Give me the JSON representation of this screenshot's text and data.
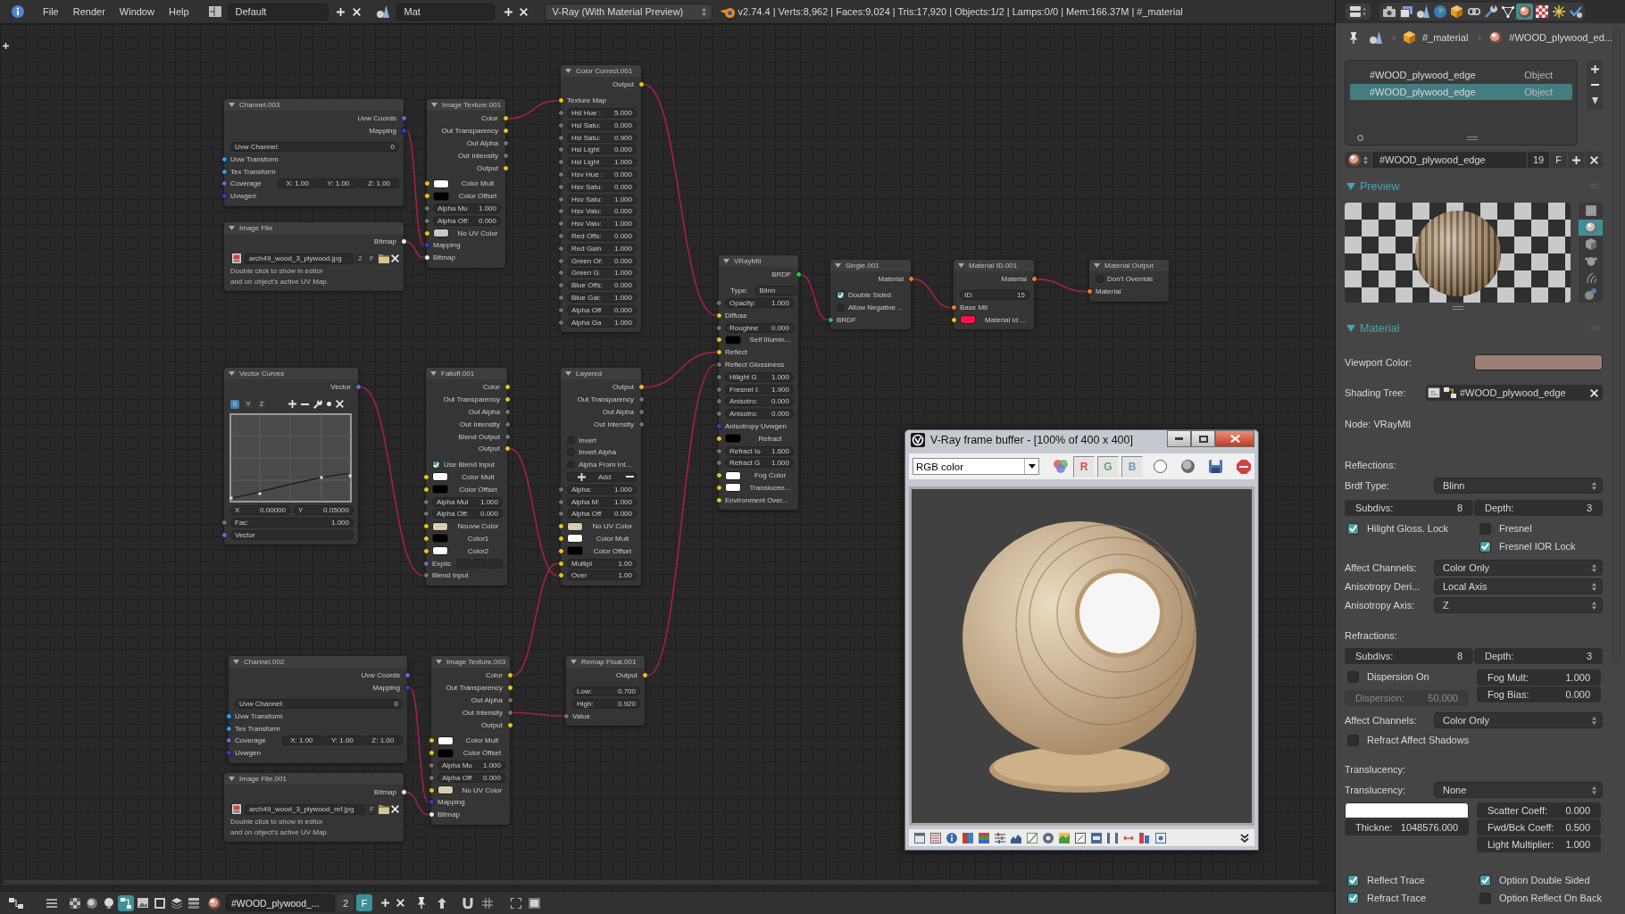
{
  "top_bar": {
    "menus": [
      "File",
      "Render",
      "Window",
      "Help"
    ],
    "layout": "Default",
    "scene": "Mat",
    "engine": "V-Ray (With Material Preview)",
    "stats": "v2.74.4 | Verts:8,962 | Faces:9,024 | Tris:17,920 | Objects:1/2 | Lamps:0/0 | Mem:166.37M | #_material"
  },
  "nodes": [
    {
      "title": "Channel.003",
      "expanded": true,
      "rows": [
        {
          "kind": "out",
          "label": "Uvw Coords",
          "socket": {
            "color": "#6a6ad6"
          }
        },
        {
          "kind": "out",
          "label": "Mapping",
          "socket": {
            "color": "#3a3ac8"
          }
        },
        {
          "kind": "field",
          "label": "Uvw Channel:",
          "value": "0"
        },
        {
          "kind": "in",
          "label": "Uvw Transform",
          "socket": {
            "color": "#2a9df4"
          }
        },
        {
          "kind": "in",
          "label": "Tex Transform",
          "socket": {
            "color": "#2a9df4"
          }
        },
        {
          "kind": "xyz",
          "label": "Coverage",
          "socket": {
            "color": "#6a6ad6"
          },
          "values": [
            "X: 1.00",
            "Y: 1.00",
            "Z: 1.00"
          ]
        },
        {
          "kind": "in",
          "label": "Uvwgen",
          "socket": {
            "color": "#3a3ac8"
          }
        }
      ]
    },
    {
      "title": "Image File",
      "expanded": true,
      "rows": [
        {
          "kind": "out",
          "label": "Bitmap",
          "socket": {
            "color": "#f2f2f2"
          }
        },
        {
          "kind": "file",
          "name": "arch49_wood_3_plywood.jpg",
          "users": "2",
          "fake_user": "F"
        },
        {
          "kind": "note",
          "text": "Double click to show in editor"
        },
        {
          "kind": "note",
          "text": "and on object's active UV Map."
        }
      ]
    },
    {
      "title": "Image Texture.001",
      "expanded": true,
      "rows": [
        {
          "kind": "out",
          "label": "Color",
          "socket": {
            "color": "#e6c41e"
          }
        },
        {
          "kind": "out",
          "label": "Out Transparency",
          "socket": {
            "color": "#e6c41e"
          }
        },
        {
          "kind": "out",
          "label": "Out Alpha",
          "socket": {
            "color": "#737373"
          }
        },
        {
          "kind": "out",
          "label": "Out Intensity",
          "socket": {
            "color": "#737373"
          }
        },
        {
          "kind": "out",
          "label": "Output",
          "socket": {
            "color": "#e6c41e"
          }
        },
        {
          "kind": "color",
          "label": "Color Mult",
          "socket": {
            "color": "#e6c41e"
          },
          "color": "#ffffff"
        },
        {
          "kind": "color",
          "label": "Color Offset",
          "socket": {
            "color": "#e6c41e"
          },
          "color": "#000000"
        },
        {
          "kind": "field",
          "label": "Alpha Mu",
          "value": "1.000",
          "socket": {
            "color": "#737373"
          }
        },
        {
          "kind": "field",
          "label": "Alpha Off:",
          "value": "0.000",
          "socket": {
            "color": "#737373"
          }
        },
        {
          "kind": "color",
          "label": "No UV Color",
          "socket": {
            "color": "#e6c41e"
          },
          "color": "#c8c8c8"
        },
        {
          "kind": "in",
          "label": "Mapping",
          "socket": {
            "color": "#3a3ac8"
          }
        },
        {
          "kind": "in",
          "label": "Bitmap",
          "socket": {
            "color": "#f2f2f2"
          }
        }
      ]
    },
    {
      "title": "Color Correct.001",
      "expanded": true,
      "rows": [
        {
          "kind": "out",
          "label": "Output",
          "socket": {
            "color": "#e6c41e"
          }
        },
        {
          "kind": "in",
          "label": "Texture Map",
          "socket": {
            "color": "#e6c41e"
          }
        },
        {
          "kind": "field",
          "label": "Hsl Hue :",
          "value": "5.000",
          "socket": {
            "color": "#737373"
          }
        },
        {
          "kind": "field",
          "label": "Hsl Satu:",
          "value": "0.000",
          "socket": {
            "color": "#737373"
          }
        },
        {
          "kind": "field",
          "label": "Hsl Satu:",
          "value": "0.900",
          "socket": {
            "color": "#737373"
          }
        },
        {
          "kind": "field",
          "label": "Hsl Light",
          "value": "0.000",
          "socket": {
            "color": "#737373"
          }
        },
        {
          "kind": "field",
          "label": "Hsl Light",
          "value": "1.000",
          "socket": {
            "color": "#737373"
          }
        },
        {
          "kind": "field",
          "label": "Hsv Hue :",
          "value": "0.000",
          "socket": {
            "color": "#737373"
          }
        },
        {
          "kind": "field",
          "label": "Hsv Satu:",
          "value": "0.000",
          "socket": {
            "color": "#737373"
          }
        },
        {
          "kind": "field",
          "label": "Hsv Satu:",
          "value": "1.000",
          "socket": {
            "color": "#737373"
          }
        },
        {
          "kind": "field",
          "label": "Hsv Valu:",
          "value": "0.000",
          "socket": {
            "color": "#737373"
          }
        },
        {
          "kind": "field",
          "label": "Hsv Valu:",
          "value": "1.000",
          "socket": {
            "color": "#737373"
          }
        },
        {
          "kind": "field",
          "label": "Red Offs:",
          "value": "0.000",
          "socket": {
            "color": "#737373"
          }
        },
        {
          "kind": "field",
          "label": "Red Gain",
          "value": "1.000",
          "socket": {
            "color": "#737373"
          }
        },
        {
          "kind": "field",
          "label": "Green Of:",
          "value": "0.000",
          "socket": {
            "color": "#737373"
          }
        },
        {
          "kind": "field",
          "label": "Green G:",
          "value": "1.000",
          "socket": {
            "color": "#737373"
          }
        },
        {
          "kind": "field",
          "label": "Blue Offs:",
          "value": "0.000",
          "socket": {
            "color": "#737373"
          }
        },
        {
          "kind": "field",
          "label": "Blue Gai:",
          "value": "1.000",
          "socket": {
            "color": "#737373"
          }
        },
        {
          "kind": "field",
          "label": "Alpha Off",
          "value": "0.000",
          "socket": {
            "color": "#737373"
          }
        },
        {
          "kind": "field",
          "label": "Alpha Ga",
          "value": "1.000",
          "socket": {
            "color": "#737373"
          }
        }
      ]
    },
    {
      "title": "VRayMtl",
      "expanded": true,
      "rows": [
        {
          "kind": "out",
          "label": "BRDF",
          "socket": {
            "color": "#33c24a"
          }
        },
        {
          "kind": "select",
          "label": "Type:",
          "value": "Blinn"
        },
        {
          "kind": "field",
          "label": "Opacity:",
          "value": "1.000",
          "socket": {
            "color": "#737373"
          }
        },
        {
          "kind": "in",
          "label": "Diffuse",
          "socket": {
            "color": "#e6c41e"
          }
        },
        {
          "kind": "field",
          "label": "Roughne",
          "value": "0.000",
          "socket": {
            "color": "#737373"
          }
        },
        {
          "kind": "color",
          "label": "Self Illumin...",
          "socket": {
            "color": "#e6c41e"
          },
          "color": "#000000"
        },
        {
          "kind": "in",
          "label": "Reflect",
          "socket": {
            "color": "#e6c41e"
          }
        },
        {
          "kind": "in",
          "label": "Reflect Glossiness",
          "socket": {
            "color": "#737373"
          }
        },
        {
          "kind": "field",
          "label": "Hilight G",
          "value": "1.000",
          "socket": {
            "color": "#737373"
          }
        },
        {
          "kind": "field",
          "label": "Fresnel I:",
          "value": "1.900",
          "socket": {
            "color": "#737373"
          }
        },
        {
          "kind": "field",
          "label": "Anisotro:",
          "value": "0.000",
          "socket": {
            "color": "#737373"
          }
        },
        {
          "kind": "field",
          "label": "Anisotro:",
          "value": "0.000",
          "socket": {
            "color": "#737373"
          }
        },
        {
          "kind": "in",
          "label": "Anisotropy Uvwgen",
          "socket": {
            "color": "#3a3ac8"
          }
        },
        {
          "kind": "color",
          "label": "Refract",
          "socket": {
            "color": "#e6c41e"
          },
          "color": "#000000"
        },
        {
          "kind": "field",
          "label": "Refract Io",
          "value": "1.600",
          "socket": {
            "color": "#737373"
          }
        },
        {
          "kind": "field",
          "label": "Refract G",
          "value": "1.000",
          "socket": {
            "color": "#737373"
          }
        },
        {
          "kind": "color",
          "label": "Fog Color",
          "socket": {
            "color": "#e6c41e"
          },
          "color": "#ffffff"
        },
        {
          "kind": "color",
          "label": "Translucen...",
          "socket": {
            "color": "#e6c41e"
          },
          "color": "#ffffff"
        },
        {
          "kind": "in",
          "label": "Environment Over...",
          "socket": {
            "color": "#e6c41e"
          }
        }
      ]
    },
    {
      "title": "Single.001",
      "expanded": true,
      "rows": [
        {
          "kind": "out",
          "label": "Material",
          "socket": {
            "color": "#f07d2a"
          }
        },
        {
          "kind": "check",
          "label": "Double Sided",
          "checked": true
        },
        {
          "kind": "check",
          "label": "Allow Negative ...",
          "checked": false
        },
        {
          "kind": "in",
          "label": "BRDF",
          "socket": {
            "color": "#33c24a"
          }
        }
      ]
    },
    {
      "title": "Material ID.001",
      "expanded": true,
      "rows": [
        {
          "kind": "out",
          "label": "Material",
          "socket": {
            "color": "#f07d2a"
          }
        },
        {
          "kind": "field",
          "label": "ID:",
          "value": "15"
        },
        {
          "kind": "in",
          "label": "Base Mtl",
          "socket": {
            "color": "#f07d2a"
          }
        },
        {
          "kind": "color",
          "label": "Material Id ...",
          "socket": {
            "color": "#e6c41e"
          },
          "color": "#f0144c"
        }
      ]
    },
    {
      "title": "Material Output",
      "expanded": true,
      "rows": [
        {
          "kind": "check",
          "label": "Don't Override",
          "checked": false
        },
        {
          "kind": "in",
          "label": "Material",
          "socket": {
            "color": "#f07d2a"
          }
        }
      ]
    },
    {
      "title": "Vector Curves",
      "expanded": true,
      "rows": [
        {
          "kind": "out",
          "label": "Vector",
          "socket": {
            "color": "#6a6ad6"
          }
        },
        {
          "kind": "curvetools",
          "axes": [
            {
              "label": "X",
              "selected": true
            },
            {
              "label": "Y",
              "selected": false
            },
            {
              "label": "Z",
              "selected": false
            }
          ]
        },
        {
          "kind": "curve"
        },
        {
          "kind": "pair",
          "fields": [
            {
              "label": "X",
              "value": "0.00000"
            },
            {
              "label": "Y",
              "value": "0.05000"
            }
          ]
        },
        {
          "kind": "field",
          "label": "Fac:",
          "value": "1.000",
          "socket": {
            "color": "#737373"
          }
        },
        {
          "kind": "bar",
          "label": "Vector",
          "socket": {
            "color": "#6a6ad6"
          }
        }
      ]
    },
    {
      "title": "Falloff.001",
      "expanded": true,
      "rows": [
        {
          "kind": "out",
          "label": "Color",
          "socket": {
            "color": "#e6c41e"
          }
        },
        {
          "kind": "out",
          "label": "Out Transparency",
          "socket": {
            "color": "#e6c41e"
          }
        },
        {
          "kind": "out",
          "label": "Out Alpha",
          "socket": {
            "color": "#737373"
          }
        },
        {
          "kind": "out",
          "label": "Out Intensity",
          "socket": {
            "color": "#737373"
          }
        },
        {
          "kind": "out",
          "label": "Blend Output",
          "socket": {
            "color": "#737373"
          }
        },
        {
          "kind": "out",
          "label": "Output",
          "socket": {
            "color": "#e6c41e"
          }
        },
        {
          "kind": "check",
          "label": "Use Blend Input",
          "checked": true
        },
        {
          "kind": "color",
          "label": "Color Mult",
          "socket": {
            "color": "#e6c41e"
          },
          "color": "#ffffff"
        },
        {
          "kind": "color",
          "label": "Color Offset",
          "socket": {
            "color": "#e6c41e"
          },
          "color": "#000000"
        },
        {
          "kind": "field",
          "label": "Alpha Mul",
          "value": "1.000",
          "socket": {
            "color": "#737373"
          }
        },
        {
          "kind": "field",
          "label": "Alpha Off:",
          "value": "0.000",
          "socket": {
            "color": "#737373"
          }
        },
        {
          "kind": "color",
          "label": "Nouvw Color",
          "socket": {
            "color": "#e6c41e"
          },
          "color": "#d4cdb2"
        },
        {
          "kind": "color",
          "label": "Color1",
          "socket": {
            "color": "#e6c41e"
          },
          "color": "#000000"
        },
        {
          "kind": "color",
          "label": "Color2",
          "socket": {
            "color": "#e6c41e"
          },
          "color": "#ffffff"
        },
        {
          "kind": "vec",
          "label": "Explic",
          "socket": {
            "color": "#6a6ad6"
          }
        },
        {
          "kind": "in",
          "label": "Blend Input",
          "socket": {
            "color": "#737373"
          }
        }
      ]
    },
    {
      "title": "Layered",
      "expanded": true,
      "rows": [
        {
          "kind": "out",
          "label": "Output",
          "socket": {
            "color": "#e6c41e"
          }
        },
        {
          "kind": "out",
          "label": "Out Transparency",
          "socket": {
            "color": "#737373"
          }
        },
        {
          "kind": "out",
          "label": "Out Alpha",
          "socket": {
            "color": "#737373"
          }
        },
        {
          "kind": "out",
          "label": "Out Intensity",
          "socket": {
            "color": "#737373"
          }
        },
        {
          "kind": "check",
          "label": "Invert",
          "checked": false
        },
        {
          "kind": "check",
          "label": "Invert Alpha",
          "checked": false
        },
        {
          "kind": "check",
          "label": "Alpha From Int...",
          "checked": false
        },
        {
          "kind": "addrow",
          "label": "Add"
        },
        {
          "kind": "field",
          "label": "Alpha:",
          "value": "1.000",
          "socket": {
            "color": "#737373"
          }
        },
        {
          "kind": "field",
          "label": "Alpha M:",
          "value": "1.000",
          "socket": {
            "color": "#737373"
          }
        },
        {
          "kind": "field",
          "label": "Alpha Off",
          "value": "0.000",
          "socket": {
            "color": "#737373"
          }
        },
        {
          "kind": "color",
          "label": "No UV Color",
          "socket": {
            "color": "#e6c41e"
          },
          "color": "#d4cdb2"
        },
        {
          "kind": "color",
          "label": "Color Mult",
          "socket": {
            "color": "#e6c41e"
          },
          "color": "#ffffff"
        },
        {
          "kind": "color",
          "label": "Color Offset",
          "socket": {
            "color": "#e6c41e"
          },
          "color": "#000000"
        },
        {
          "kind": "field",
          "label": "Multipl",
          "value": "1.00",
          "socket": {
            "color": "#e6c41e"
          }
        },
        {
          "kind": "field",
          "label": "Over",
          "value": "1.00",
          "socket": {
            "color": "#e6c41e"
          }
        }
      ]
    },
    {
      "title": "Channel.002",
      "expanded": true,
      "rows": [
        {
          "kind": "out",
          "label": "Uvw Coords",
          "socket": {
            "color": "#6a6ad6"
          }
        },
        {
          "kind": "out",
          "label": "Mapping",
          "socket": {
            "color": "#3a3ac8"
          }
        },
        {
          "kind": "field",
          "label": "Uvw Channel:",
          "value": "0"
        },
        {
          "kind": "in",
          "label": "Uvw Transform",
          "socket": {
            "color": "#2a9df4"
          }
        },
        {
          "kind": "in",
          "label": "Tex Transform",
          "socket": {
            "color": "#2a9df4"
          }
        },
        {
          "kind": "xyz",
          "label": "Coverage",
          "socket": {
            "color": "#6a6ad6"
          },
          "values": [
            "X: 1.00",
            "Y: 1.00",
            "Z: 1.00"
          ]
        },
        {
          "kind": "in",
          "label": "Uvwgen",
          "socket": {
            "color": "#3a3ac8"
          }
        }
      ]
    },
    {
      "title": "Image File.001",
      "expanded": true,
      "rows": [
        {
          "kind": "out",
          "label": "Bitmap",
          "socket": {
            "color": "#f2f2f2"
          }
        },
        {
          "kind": "file",
          "name": "arch49_wood_3_plywood_ref.jpg",
          "fake_user": "F"
        },
        {
          "kind": "note",
          "text": "Double click to show in editor"
        },
        {
          "kind": "note",
          "text": "and on object's active UV Map."
        }
      ]
    },
    {
      "title": "Image Texture.003",
      "expanded": true,
      "rows": [
        {
          "kind": "out",
          "label": "Color",
          "socket": {
            "color": "#e6c41e"
          }
        },
        {
          "kind": "out",
          "label": "Out Transparency",
          "socket": {
            "color": "#e6c41e"
          }
        },
        {
          "kind": "out",
          "label": "Out Alpha",
          "socket": {
            "color": "#737373"
          }
        },
        {
          "kind": "out",
          "label": "Out Intensity",
          "socket": {
            "color": "#737373"
          }
        },
        {
          "kind": "out",
          "label": "Output",
          "socket": {
            "color": "#e6c41e"
          }
        },
        {
          "kind": "color",
          "label": "Color Mult",
          "socket": {
            "color": "#e6c41e"
          },
          "color": "#ffffff"
        },
        {
          "kind": "color",
          "label": "Color Offset",
          "socket": {
            "color": "#e6c41e"
          },
          "color": "#000000"
        },
        {
          "kind": "field",
          "label": "Alpha Mu",
          "value": "1.000",
          "socket": {
            "color": "#737373"
          }
        },
        {
          "kind": "field",
          "label": "Alpha Off",
          "value": "0.000",
          "socket": {
            "color": "#737373"
          }
        },
        {
          "kind": "color",
          "label": "No UV Color",
          "socket": {
            "color": "#e6c41e"
          },
          "color": "#d4cdb2"
        },
        {
          "kind": "in",
          "label": "Mapping",
          "socket": {
            "color": "#3a3ac8"
          }
        },
        {
          "kind": "in",
          "label": "Bitmap",
          "socket": {
            "color": "#f2f2f2"
          }
        }
      ]
    },
    {
      "title": "Remap Float.001",
      "expanded": true,
      "rows": [
        {
          "kind": "out",
          "label": "Output",
          "socket": {
            "color": "#e6c41e"
          }
        },
        {
          "kind": "field",
          "label": "Low:",
          "value": "0.700"
        },
        {
          "kind": "field",
          "label": "High:",
          "value": "0.920"
        },
        {
          "kind": "in",
          "label": "Value",
          "socket": {
            "color": "#737373"
          }
        }
      ]
    }
  ],
  "frame_buffer": {
    "title": "V-Ray frame buffer - [100% of 400 x 400]",
    "channel": "RGB color",
    "channel_toggles": [
      {
        "label": "R",
        "on": true
      },
      {
        "label": "G",
        "on": true
      },
      {
        "label": "B",
        "on": true
      }
    ]
  },
  "node_editor_header": {
    "tool_icons": [
      {
        "selected": false
      },
      {
        "selected": false
      },
      {
        "selected": false
      },
      {
        "selected": true
      },
      {
        "selected": false
      },
      {
        "selected": false
      },
      {
        "selected": false
      },
      {
        "selected": false
      }
    ],
    "material": "#WOOD_plywood_...",
    "users": "2",
    "fake_user": {
      "label": "F",
      "on": true
    }
  },
  "properties": {
    "tabs": [
      {
        "selected": false
      },
      {
        "selected": false
      },
      {
        "selected": false
      },
      {
        "selected": false
      },
      {
        "selected": false
      },
      {
        "selected": false
      },
      {
        "selected": false
      },
      {
        "selected": false
      },
      {
        "selected": true
      },
      {
        "selected": false
      },
      {
        "selected": false
      },
      {
        "selected": false
      }
    ],
    "breadcrumb": [
      "#_material",
      "#WOOD_plywood_ed..."
    ],
    "slots": [
      {
        "name": "#WOOD_plywood_edge",
        "link": "Object",
        "selected": false
      },
      {
        "name": "#WOOD_plywood_edge",
        "link": "Object",
        "selected": true
      }
    ],
    "material": {
      "name": "#WOOD_plywood_edge",
      "users": "19",
      "fake_user": {
        "label": "F",
        "on": false
      }
    },
    "panels": [
      {
        "title": "Preview",
        "expanded": true,
        "shapes": [
          {
            "selected": false
          },
          {
            "selected": true
          },
          {
            "selected": false
          },
          {
            "selected": false
          },
          {
            "selected": false
          },
          {
            "selected": false
          }
        ]
      },
      {
        "title": "Material",
        "expanded": true,
        "rows": [
          {
            "kind": "color",
            "label": "Viewport Color:",
            "color": "#9d7f76"
          },
          {
            "kind": "tree",
            "label": "Shading Tree:",
            "value": "#WOOD_plywood_edge"
          },
          {
            "kind": "text",
            "text": "Node: VRayMtl"
          },
          {
            "kind": "heading",
            "text": "Reflections:"
          },
          {
            "kind": "select",
            "label": "Brdf Type:",
            "value": "Blinn"
          },
          {
            "kind": "pair",
            "fields": [
              {
                "label": "Subdivs:",
                "value": "8"
              },
              {
                "label": "Depth:",
                "value": "3"
              }
            ]
          },
          {
            "kind": "split",
            "left": [
              {
                "kind": "check",
                "label": "Hilight Gloss. Lock",
                "checked": true
              }
            ],
            "right": [
              {
                "kind": "check",
                "label": "Fresnel",
                "checked": false
              },
              {
                "kind": "check",
                "label": "Fresnel IOR Lock",
                "checked": true
              }
            ]
          },
          {
            "kind": "select",
            "label": "Affect Channels:",
            "value": "Color Only"
          },
          {
            "kind": "select",
            "label": "Anisotropy Deri...",
            "value": "Local Axis"
          },
          {
            "kind": "select",
            "label": "Anisotropy Axis:",
            "value": "Z"
          },
          {
            "kind": "heading",
            "text": "Refractions:"
          },
          {
            "kind": "pair",
            "fields": [
              {
                "label": "Subdivs:",
                "value": "8"
              },
              {
                "label": "Depth:",
                "value": "3"
              }
            ]
          },
          {
            "kind": "split",
            "left": [
              {
                "kind": "check",
                "label": "Dispersion On",
                "checked": false
              },
              {
                "kind": "field",
                "label": "Dispersion:",
                "value": "50.000",
                "disabled": true
              }
            ],
            "right": [
              {
                "kind": "field",
                "label": "Fog Mult:",
                "value": "1.000",
                "disabled": false
              },
              {
                "kind": "field",
                "label": "Fog Bias:",
                "value": "0.000",
                "disabled": false
              }
            ]
          },
          {
            "kind": "select",
            "label": "Affect Channels:",
            "value": "Color Only"
          },
          {
            "kind": "split",
            "left": [
              {
                "kind": "check",
                "label": "Refract Affect Shadows",
                "checked": false
              }
            ]
          },
          {
            "kind": "heading",
            "text": "Translucency:"
          },
          {
            "kind": "select",
            "label": "Translucency:",
            "value": "None"
          },
          {
            "kind": "split",
            "left": [
              {
                "kind": "swatch",
                "color": "#ffffff"
              },
              {
                "kind": "field",
                "label": "Thickne:",
                "value": "1048576.000",
                "disabled": false
              }
            ],
            "right": [
              {
                "kind": "field",
                "label": "Scatter Coeff:",
                "value": "0.000",
                "disabled": false
              },
              {
                "kind": "field",
                "label": "Fwd/Bck Coeff:",
                "value": "0.500",
                "disabled": false
              },
              {
                "kind": "field",
                "label": "Light Multiplier:",
                "value": "1.000",
                "disabled": false
              }
            ]
          },
          {
            "kind": "split",
            "left": [
              {
                "kind": "check",
                "label": "Reflect Trace",
                "checked": true
              },
              {
                "kind": "check",
                "label": "Refract Trace",
                "checked": true
              }
            ],
            "right": [
              {
                "kind": "check",
                "label": "Option Double Sided",
                "checked": true
              },
              {
                "kind": "check",
                "label": "Option Reflect On Back",
                "checked": false
              }
            ]
          }
        ]
      }
    ]
  }
}
